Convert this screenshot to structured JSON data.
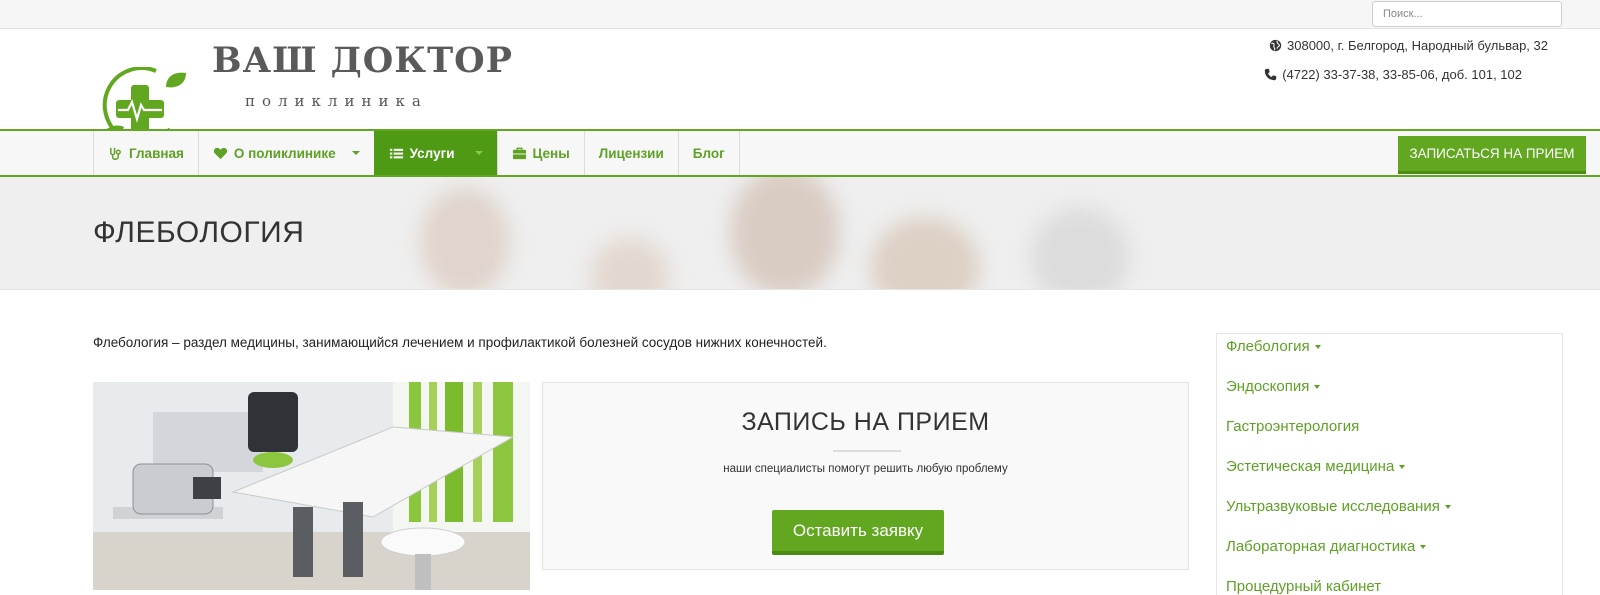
{
  "search": {
    "placeholder": "Поиск..."
  },
  "logo": {
    "title": "ВАШ ДОКТОР",
    "subtitle": "поликлиника"
  },
  "contacts": {
    "address": "308000, г. Белгород, Народный бульвар, 32",
    "phone": "(4722) 33-37-38, 33-85-06, доб. 101, 102"
  },
  "nav": {
    "items": [
      {
        "label": "Главная",
        "icon": "stethoscope-icon"
      },
      {
        "label": "О поликлинике",
        "icon": "heart-icon",
        "dropdown": true
      },
      {
        "label": "Услуги",
        "icon": "list-icon",
        "dropdown": true,
        "active": true
      },
      {
        "label": "Цены",
        "icon": "briefcase-icon"
      },
      {
        "label": "Лицензии"
      },
      {
        "label": "Блог"
      }
    ],
    "cta": "ЗАПИСАТЬСЯ НА ПРИЕМ"
  },
  "page": {
    "title": "ФЛЕБОЛОГИЯ",
    "intro": "Флебология – раздел медицины, занимающийся лечением и профилактикой болезней сосудов нижних конечностей."
  },
  "appointment": {
    "title": "ЗАПИСЬ НА ПРИЕМ",
    "text": "наши специалисты помогут решить любую проблему",
    "button": "Оставить заявку"
  },
  "sidebar": {
    "items": [
      {
        "label": "Флебология",
        "dropdown": true
      },
      {
        "label": "Эндоскопия",
        "dropdown": true
      },
      {
        "label": "Гастроэнтерология",
        "dropdown": false
      },
      {
        "label": "Эстетическая медицина",
        "dropdown": true
      },
      {
        "label": "Ультразвуковые исследования",
        "dropdown": true
      },
      {
        "label": "Лабораторная диагностика",
        "dropdown": true
      },
      {
        "label": "Процедурный кабинет",
        "dropdown": false
      }
    ]
  },
  "colors": {
    "accent": "#62a720",
    "accent_dark": "#4e9a15",
    "text": "#333333"
  }
}
